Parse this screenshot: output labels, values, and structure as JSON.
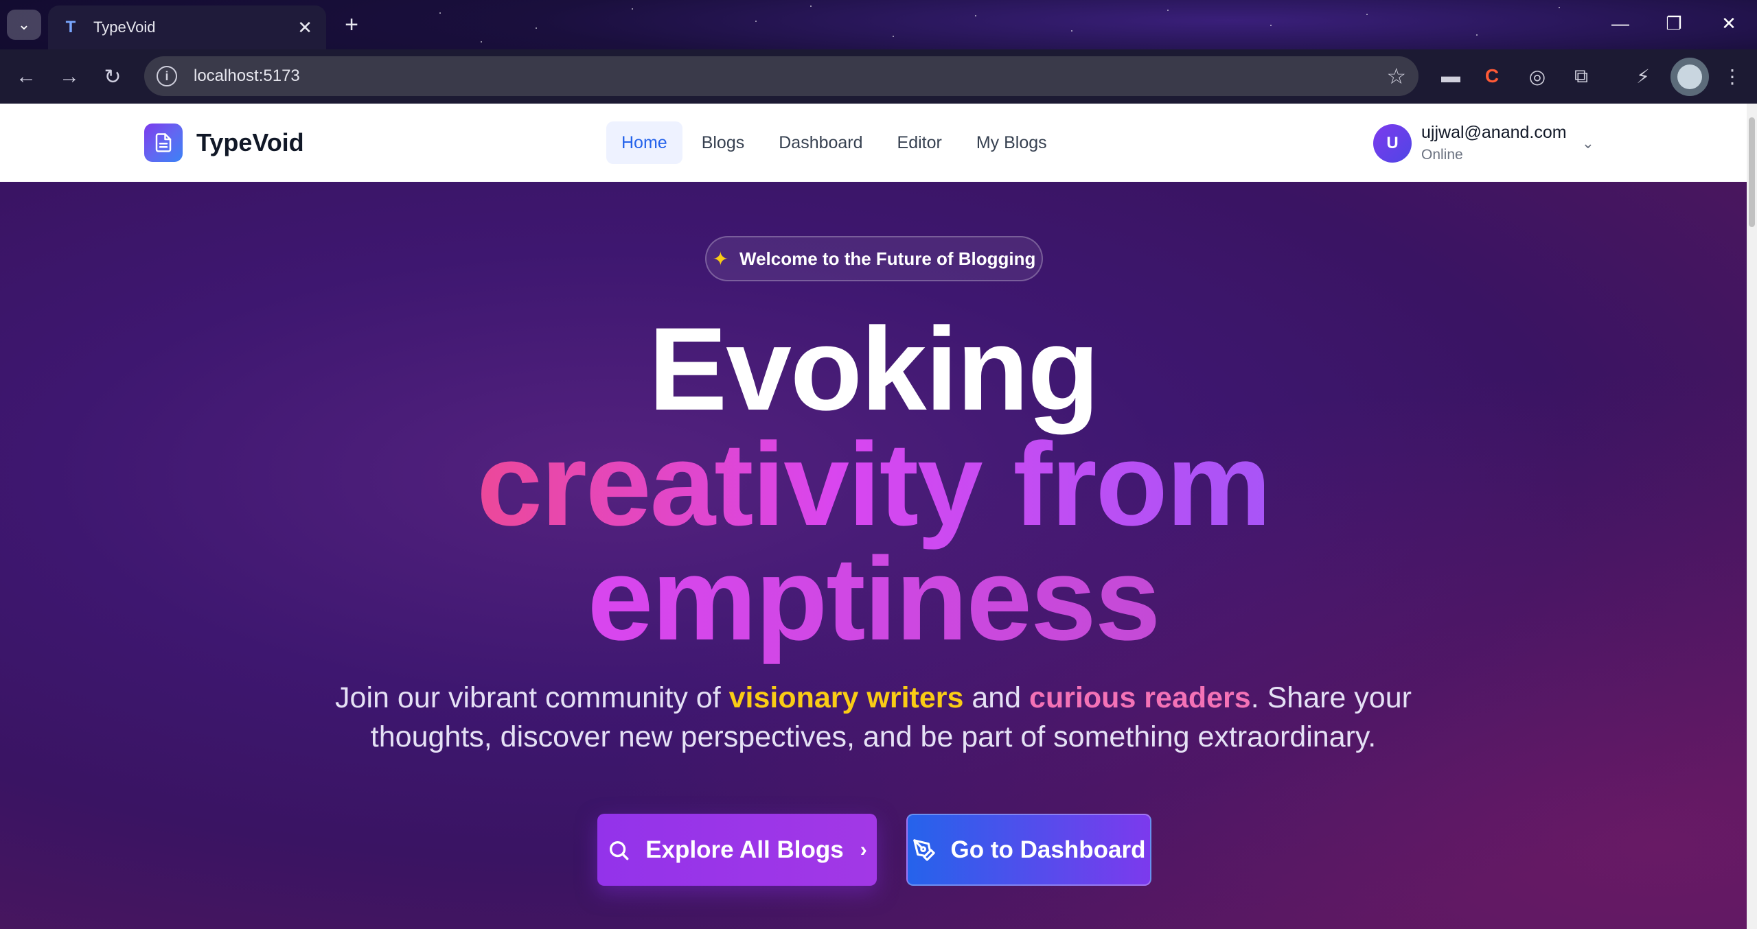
{
  "browser": {
    "tab_title": "TypeVoid",
    "url": "localhost:5173",
    "window_controls": [
      "minimize-icon",
      "restore-icon",
      "close-icon"
    ]
  },
  "header": {
    "logo_text": "TypeVoid",
    "nav": [
      {
        "label": "Home",
        "active": true
      },
      {
        "label": "Blogs",
        "active": false
      },
      {
        "label": "Dashboard",
        "active": false
      },
      {
        "label": "Editor",
        "active": false
      },
      {
        "label": "My Blogs",
        "active": false
      }
    ],
    "user": {
      "avatar_letter": "U",
      "email": "ujjwal@anand.com",
      "status": "Online"
    }
  },
  "hero": {
    "badge": "Welcome to the Future of Blogging",
    "title_line1": "Evoking",
    "title_line2": "creativity from",
    "title_line3": "emptiness",
    "subtitle_part1": "Join our vibrant community of ",
    "subtitle_highlight1": "visionary writers",
    "subtitle_part2": " and ",
    "subtitle_highlight2": "curious readers",
    "subtitle_part3": ". Share your thoughts, discover new perspectives, and be part of something extraordinary.",
    "primary_button": "Explore All Blogs",
    "secondary_button": "Go to Dashboard"
  },
  "colors": {
    "accent_blue": "#2563eb",
    "accent_purple": "#9333ea",
    "highlight_yellow": "#facc15",
    "highlight_pink": "#f472b6"
  }
}
